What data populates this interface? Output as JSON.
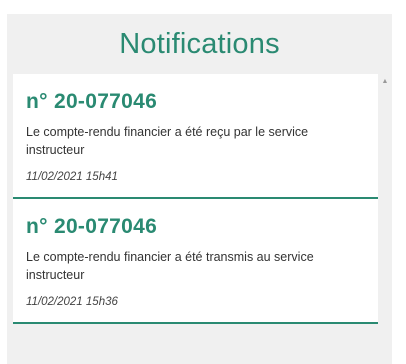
{
  "panel": {
    "title": "Notifications"
  },
  "notifications": [
    {
      "title": "n° 20-077046",
      "message": "Le compte-rendu financier a été reçu par le service instructeur",
      "date": "11/02/2021 15h41"
    },
    {
      "title": "n° 20-077046",
      "message": "Le compte-rendu financier a été transmis au service instructeur",
      "date": "11/02/2021 15h36"
    }
  ],
  "colors": {
    "accent": "#2a8a72",
    "panel_background": "#f0f0f0",
    "card_background": "#ffffff"
  },
  "icons": {
    "scroll_up": "scroll-up-arrow-icon"
  }
}
